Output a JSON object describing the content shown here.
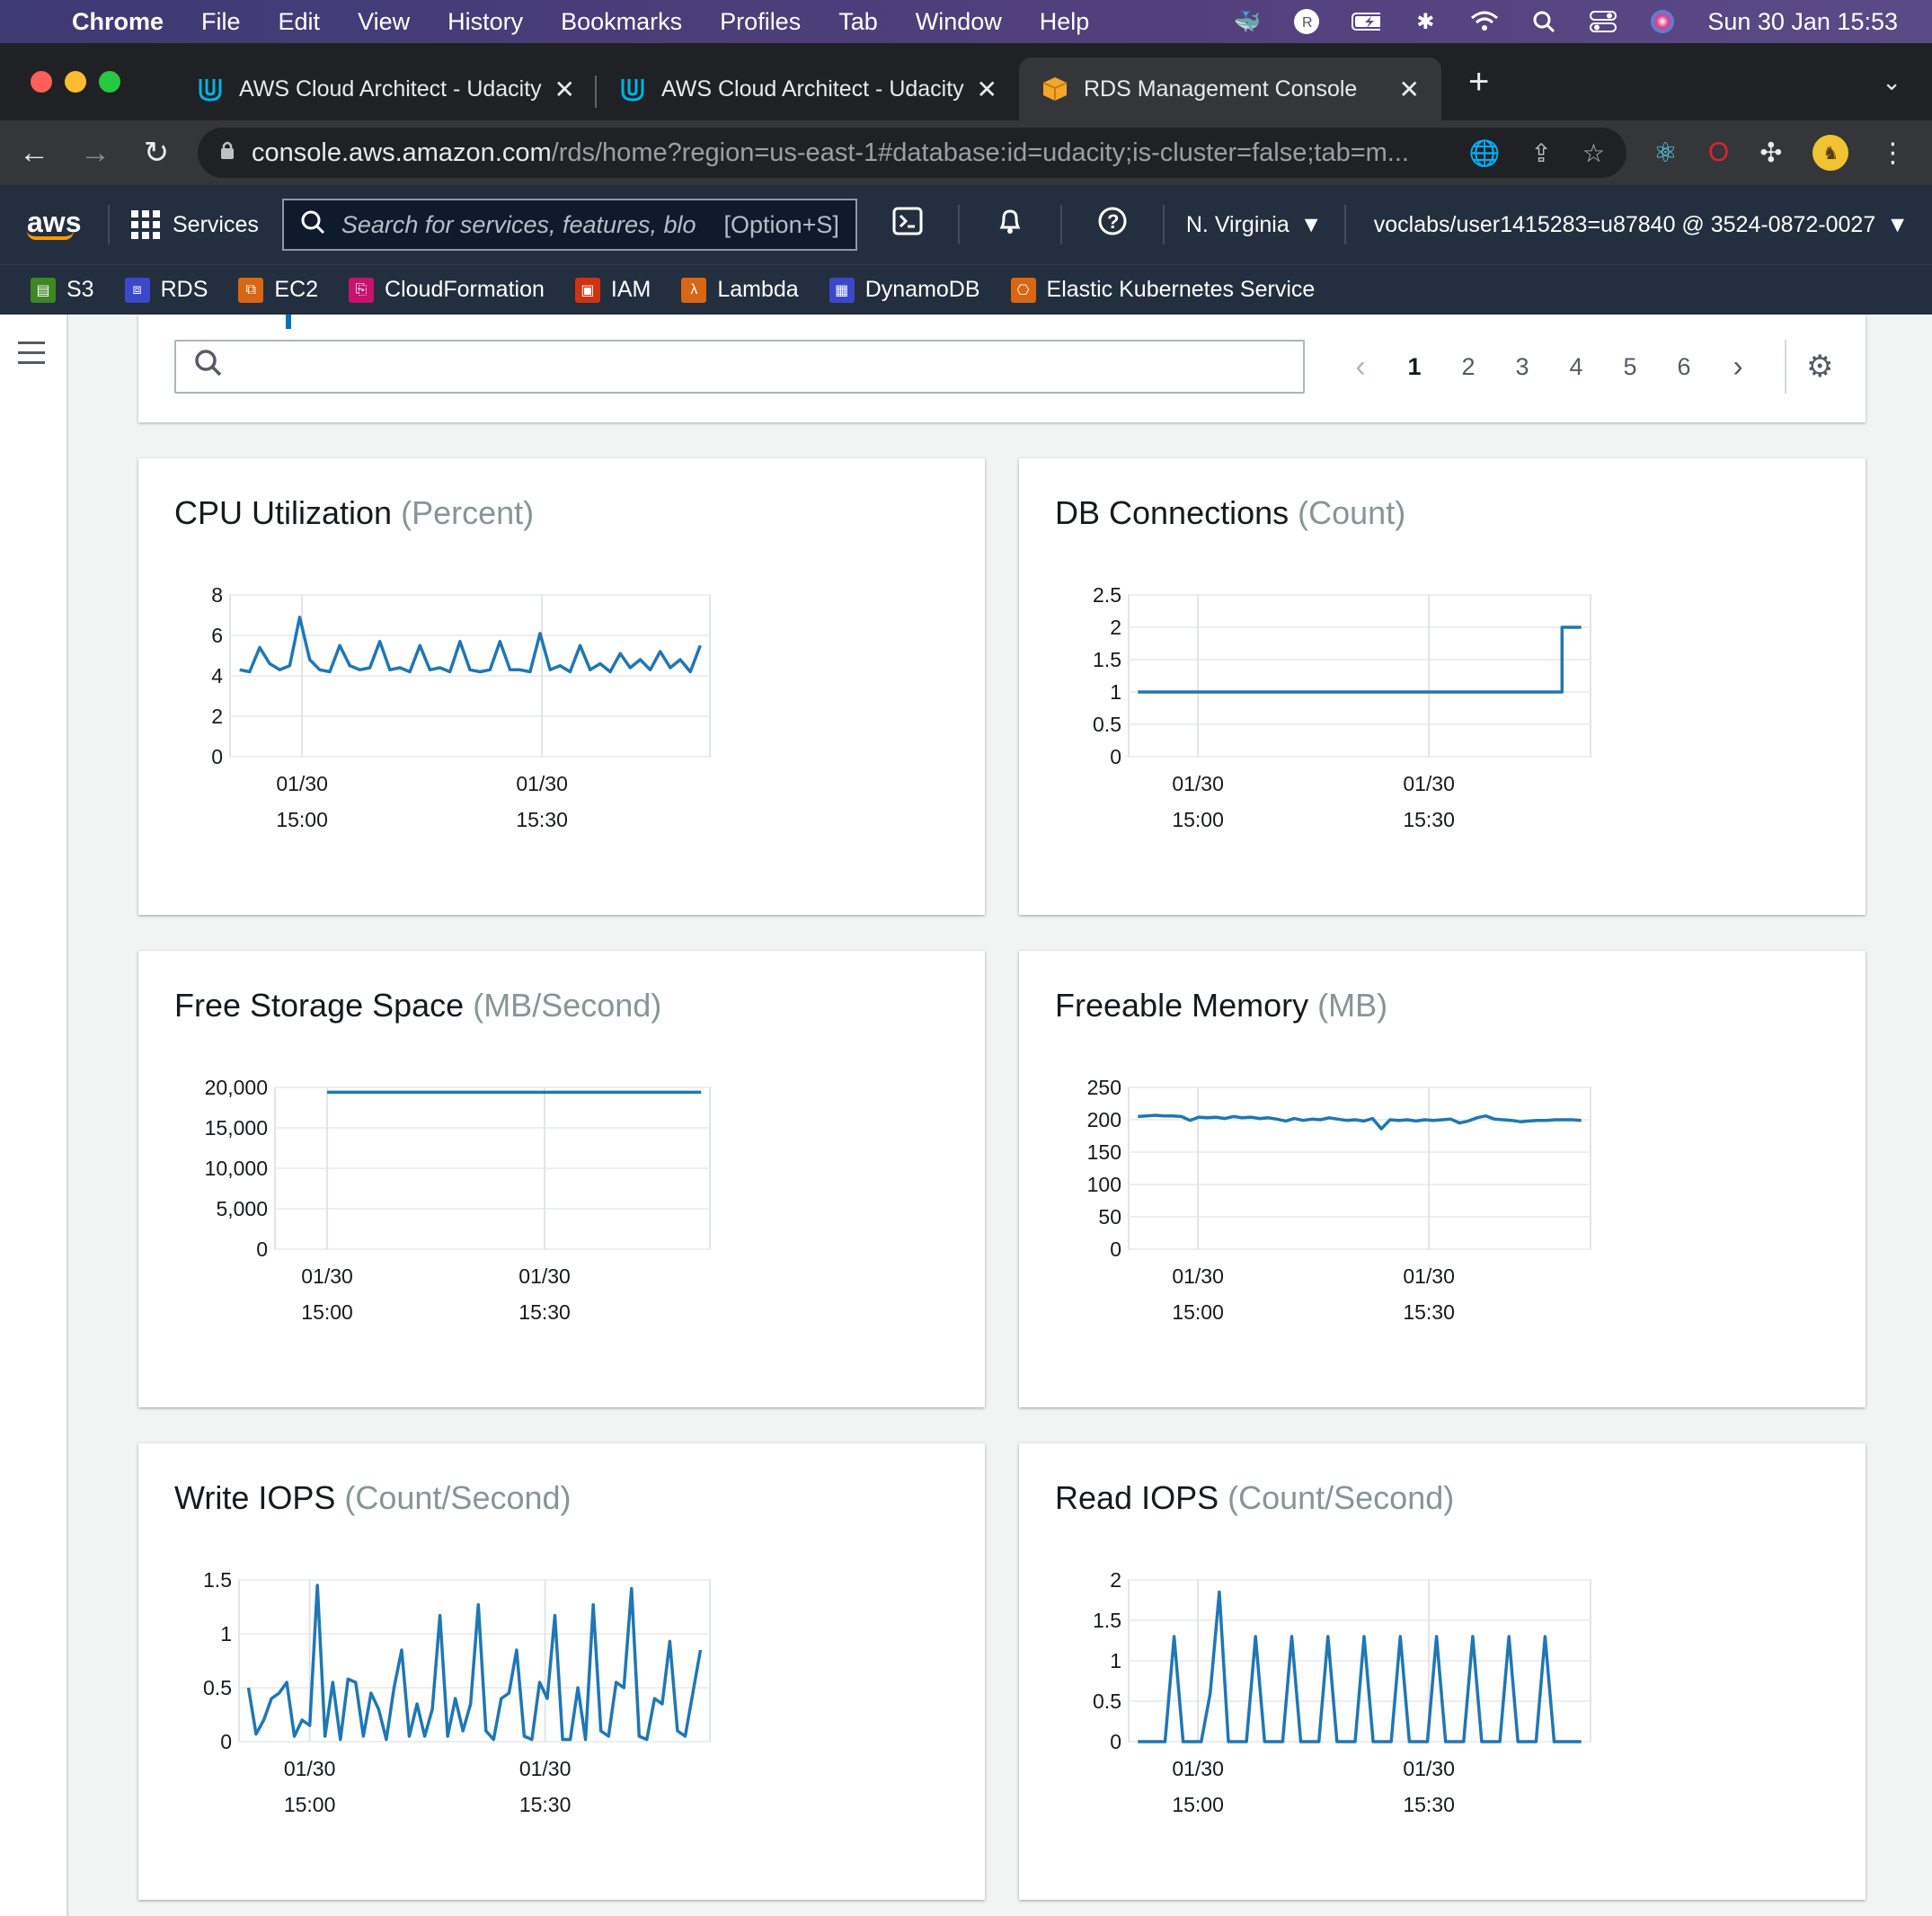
{
  "menubar": {
    "app": "Chrome",
    "items": [
      "File",
      "Edit",
      "View",
      "History",
      "Bookmarks",
      "Profiles",
      "Tab",
      "Window",
      "Help"
    ],
    "datetime": "Sun 30 Jan  15:53"
  },
  "tabs": [
    {
      "title": "AWS Cloud Architect - Udacity",
      "icon": "udacity-icon",
      "active": false
    },
    {
      "title": "AWS Cloud Architect - Udacity",
      "icon": "udacity-icon",
      "active": false
    },
    {
      "title": "RDS Management Console",
      "icon": "aws-box-icon",
      "active": true
    }
  ],
  "address": {
    "host": "console.aws.amazon.com",
    "path": "/rds/home?region=us-east-1#database:id=udacity;is-cluster=false;tab=m..."
  },
  "aws_nav": {
    "logo": "aws",
    "services_label": "Services",
    "search_placeholder": "Search for services, features, blo",
    "search_shortcut": "[Option+S]",
    "region": "N. Virginia",
    "account": "voclabs/user1415283=u87840 @ 3524-0872-0027"
  },
  "favorites": [
    {
      "label": "S3",
      "color": "#3f8624"
    },
    {
      "label": "RDS",
      "color": "#3b48cc"
    },
    {
      "label": "EC2",
      "color": "#d86613"
    },
    {
      "label": "CloudFormation",
      "color": "#c7136f"
    },
    {
      "label": "IAM",
      "color": "#d13212"
    },
    {
      "label": "Lambda",
      "color": "#d86613"
    },
    {
      "label": "DynamoDB",
      "color": "#3b48cc"
    },
    {
      "label": "Elastic Kubernetes Service",
      "color": "#d86613"
    }
  ],
  "pagination": {
    "pages": [
      "1",
      "2",
      "3",
      "4",
      "5",
      "6"
    ],
    "current": "1"
  },
  "chart_data": [
    {
      "type": "line",
      "title": "CPU Utilization",
      "unit": "(Percent)",
      "x_ticks": [
        [
          "01/30",
          "15:00"
        ],
        [
          "01/30",
          "15:30"
        ]
      ],
      "y_ticks": [
        "8",
        "6",
        "4",
        "2",
        "0"
      ],
      "ylim": [
        0,
        8
      ],
      "x_range_minutes": [
        14.1,
        15.4,
        16.0,
        16.2,
        16.4
      ],
      "values": [
        4.3,
        4.2,
        5.4,
        4.6,
        4.3,
        4.5,
        6.9,
        4.8,
        4.3,
        4.2,
        5.5,
        4.5,
        4.3,
        4.4,
        5.7,
        4.3,
        4.4,
        4.2,
        5.5,
        4.3,
        4.4,
        4.2,
        5.7,
        4.3,
        4.2,
        4.3,
        5.7,
        4.3,
        4.3,
        4.2,
        6.1,
        4.3,
        4.5,
        4.2,
        5.5,
        4.3,
        4.6,
        4.2,
        5.1,
        4.4,
        4.8,
        4.3,
        5.2,
        4.4,
        4.8,
        4.2,
        5.5
      ],
      "x_labels_pos": [
        0.15,
        0.65
      ],
      "series_color": "#1f77b4"
    },
    {
      "type": "line",
      "title": "DB Connections",
      "unit": "(Count)",
      "x_ticks": [
        [
          "01/30",
          "15:00"
        ],
        [
          "01/30",
          "15:30"
        ]
      ],
      "y_ticks": [
        "2.5",
        "2",
        "1.5",
        "1",
        "0.5",
        "0"
      ],
      "ylim": [
        0,
        2.5
      ],
      "values": [
        1,
        1,
        1,
        1,
        1,
        1,
        1,
        1,
        1,
        1,
        1,
        1,
        1,
        1,
        1,
        1,
        1,
        1,
        1,
        1,
        1,
        1,
        1,
        1,
        1,
        1,
        1,
        1,
        1,
        1,
        1,
        1,
        1,
        1,
        1,
        1,
        1,
        1,
        1,
        1,
        1,
        1,
        1,
        1,
        2,
        2,
        2
      ],
      "series_color": "#1f77b4"
    },
    {
      "type": "line",
      "title": "Free Storage Space",
      "unit": "(MB/Second)",
      "x_ticks": [
        [
          "01/30",
          "15:00"
        ],
        [
          "01/30",
          "15:30"
        ]
      ],
      "y_ticks": [
        "20,000",
        "15,000",
        "10,000",
        "5,000",
        "0"
      ],
      "ylim": [
        0,
        20000
      ],
      "values": [
        19400,
        19400,
        19400,
        19400,
        19400,
        19400,
        19400,
        19400,
        19400,
        19400
      ],
      "series_color": "#1f77b4"
    },
    {
      "type": "line",
      "title": "Freeable Memory",
      "unit": "(MB)",
      "x_ticks": [
        [
          "01/30",
          "15:00"
        ],
        [
          "01/30",
          "15:30"
        ]
      ],
      "y_ticks": [
        "250",
        "200",
        "150",
        "100",
        "50",
        "0"
      ],
      "ylim": [
        0,
        250
      ],
      "values": [
        205,
        206,
        207,
        206,
        206,
        205,
        199,
        204,
        203,
        204,
        202,
        205,
        203,
        204,
        202,
        203,
        201,
        198,
        202,
        199,
        201,
        200,
        203,
        201,
        199,
        200,
        198,
        202,
        186,
        200,
        199,
        200,
        198,
        200,
        199,
        200,
        201,
        195,
        198,
        203,
        206,
        201,
        200,
        199,
        197,
        198,
        199,
        199,
        200,
        200,
        200,
        199
      ],
      "series_color": "#1f77b4"
    },
    {
      "type": "line",
      "title": "Write IOPS",
      "unit": "(Count/Second)",
      "x_ticks": [
        [
          "01/30",
          "15:00"
        ],
        [
          "01/30",
          "15:30"
        ]
      ],
      "y_ticks": [
        "1.5",
        "1",
        "0.5",
        "0"
      ],
      "ylim": [
        0,
        1.5
      ],
      "values": [
        0.5,
        0.07,
        0.2,
        0.4,
        0.45,
        0.55,
        0.05,
        0.2,
        0.15,
        1.45,
        0.05,
        0.55,
        0.02,
        0.58,
        0.55,
        0.05,
        0.45,
        0.3,
        0.02,
        0.5,
        0.85,
        0.05,
        0.35,
        0.05,
        0.3,
        1.17,
        0.05,
        0.4,
        0.1,
        0.35,
        1.27,
        0.1,
        0.02,
        0.4,
        0.45,
        0.85,
        0.05,
        0.02,
        0.55,
        0.4,
        1.17,
        0.02,
        0.02,
        0.5,
        0.02,
        1.27,
        0.1,
        0.05,
        0.55,
        0.5,
        1.42,
        0.05,
        0.02,
        0.4,
        0.35,
        0.93,
        0.1,
        0.05,
        0.45,
        0.85
      ],
      "series_color": "#1f77b4"
    },
    {
      "type": "line",
      "title": "Read IOPS",
      "unit": "(Count/Second)",
      "x_ticks": [
        [
          "01/30",
          "15:00"
        ],
        [
          "01/30",
          "15:30"
        ]
      ],
      "y_ticks": [
        "2",
        "1.5",
        "1",
        "0.5",
        "0"
      ],
      "ylim": [
        0,
        2
      ],
      "values": [
        0,
        0,
        0,
        0,
        1.3,
        0,
        0,
        0,
        0.6,
        1.85,
        0,
        0,
        0,
        1.3,
        0,
        0,
        0,
        1.3,
        0,
        0,
        0,
        1.3,
        0,
        0,
        0,
        1.3,
        0,
        0,
        0,
        1.3,
        0,
        0,
        0,
        1.3,
        0,
        0,
        0,
        1.3,
        0,
        0,
        0,
        1.3,
        0,
        0,
        0,
        1.3,
        0,
        0,
        0,
        0
      ],
      "series_color": "#1f77b4"
    }
  ]
}
